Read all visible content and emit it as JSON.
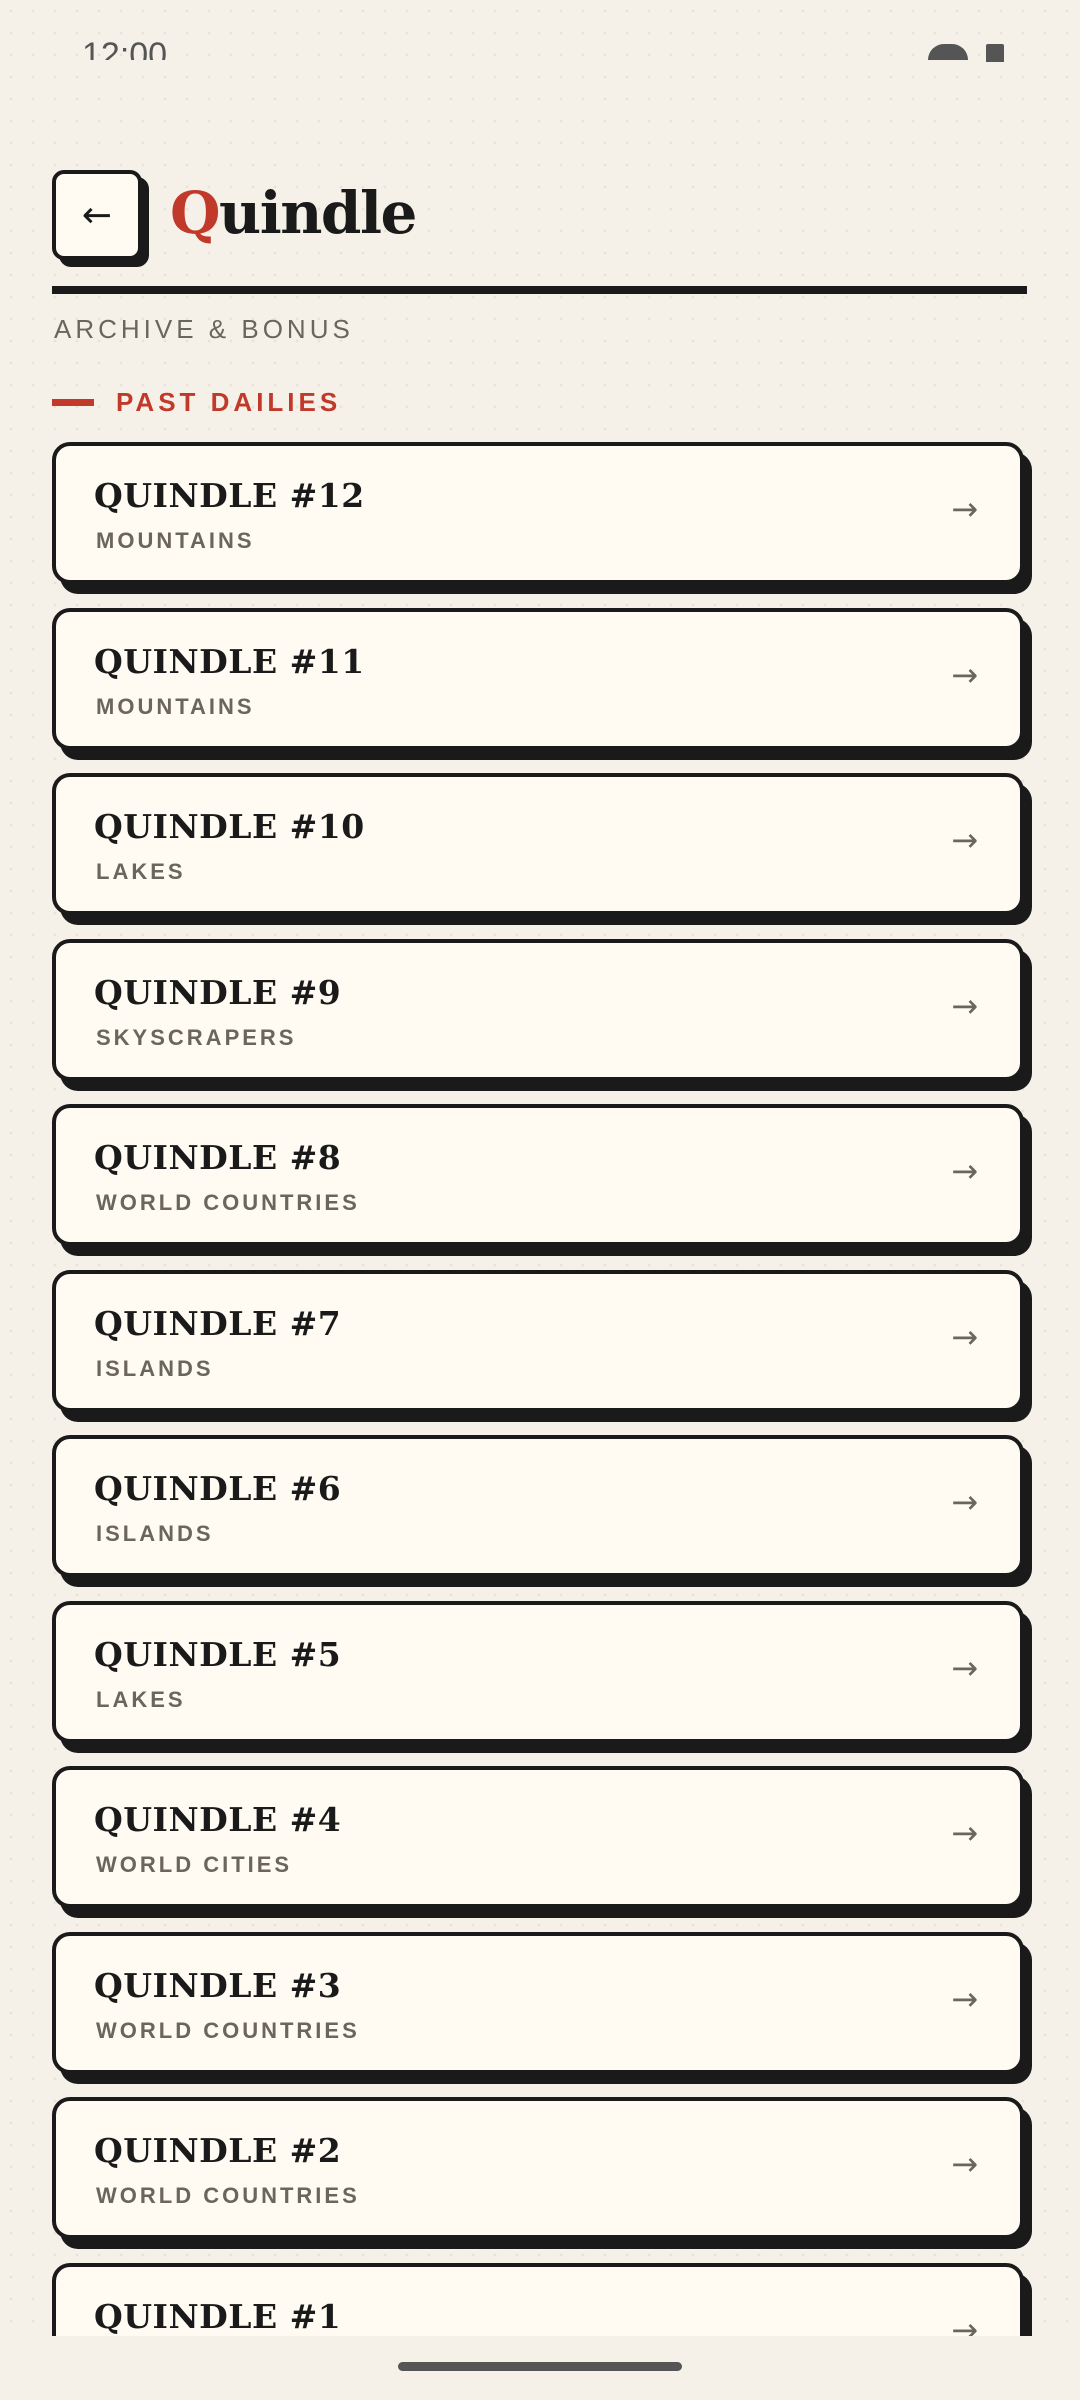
{
  "status_bar": {
    "time": "12:00",
    "icons": [
      "eye-icon",
      "battery-icon"
    ]
  },
  "header": {
    "back_label": "←",
    "brand_first": "Q",
    "brand_rest": "uindle"
  },
  "subtitle": "ARCHIVE & BONUS",
  "section": {
    "label": "PAST DAILIES"
  },
  "list": {
    "arrow": "→",
    "items": [
      {
        "title": "QUINDLE #12",
        "category": "MOUNTAINS"
      },
      {
        "title": "QUINDLE #11",
        "category": "MOUNTAINS"
      },
      {
        "title": "QUINDLE #10",
        "category": "LAKES"
      },
      {
        "title": "QUINDLE #9",
        "category": "SKYSCRAPERS"
      },
      {
        "title": "QUINDLE #8",
        "category": "WORLD COUNTRIES"
      },
      {
        "title": "QUINDLE #7",
        "category": "ISLANDS"
      },
      {
        "title": "QUINDLE #6",
        "category": "ISLANDS"
      },
      {
        "title": "QUINDLE #5",
        "category": "LAKES"
      },
      {
        "title": "QUINDLE #4",
        "category": "WORLD CITIES"
      },
      {
        "title": "QUINDLE #3",
        "category": "WORLD COUNTRIES"
      },
      {
        "title": "QUINDLE #2",
        "category": "WORLD COUNTRIES"
      },
      {
        "title": "QUINDLE #1",
        "category": ""
      }
    ]
  },
  "colors": {
    "accent": "#c0392b",
    "ink": "#1a1a1a",
    "paper": "#fffbf2",
    "background": "#f5f1e8",
    "muted": "#6b665d"
  }
}
